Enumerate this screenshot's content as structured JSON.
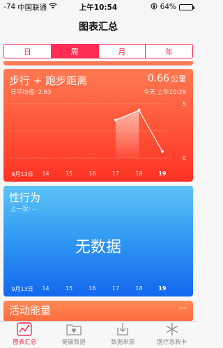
{
  "status": {
    "signal": "-74",
    "carrier": "中国联通",
    "time": "上午10:54",
    "battery": "64%",
    "battery_level": 0.64
  },
  "header": {
    "title": "图表汇总"
  },
  "segments": [
    {
      "label": "日",
      "active": false
    },
    {
      "label": "周",
      "active": true
    },
    {
      "label": "月",
      "active": false
    },
    {
      "label": "年",
      "active": false
    }
  ],
  "cards": {
    "walk": {
      "title": "步行 + 跑步距离",
      "sub": "日平均值: 2.63",
      "value": "0.66",
      "unit": "公里",
      "time": "今天 上午10:29"
    },
    "sex": {
      "title": "性行为",
      "sub": "上一次: --",
      "empty": "无数据"
    },
    "energy": {
      "title": "活动能量",
      "value": "--"
    }
  },
  "chart_data": [
    {
      "type": "area",
      "x": [
        "9月13日",
        "14",
        "15",
        "16",
        "17",
        "18",
        "19"
      ],
      "series": [
        {
          "values": [
            null,
            null,
            null,
            null,
            3.5,
            4.4,
            0.6
          ]
        }
      ],
      "ylim": [
        0,
        5
      ],
      "yticks": [
        "5",
        "0"
      ],
      "grid": true,
      "title": "",
      "xlabel": "",
      "ylabel": ""
    },
    {
      "type": "line",
      "x": [
        "9月13日",
        "14",
        "15",
        "16",
        "17",
        "18",
        "19"
      ],
      "series": [],
      "grid": false,
      "title": "",
      "xlabel": "",
      "ylabel": ""
    }
  ],
  "tabs": [
    {
      "label": "图表汇总",
      "icon": "dashboard-icon",
      "active": true
    },
    {
      "label": "健康数据",
      "icon": "health-data-icon",
      "active": false
    },
    {
      "label": "数据来源",
      "icon": "sources-icon",
      "active": false
    },
    {
      "label": "医疗急救卡",
      "icon": "medical-id-icon",
      "active": false
    }
  ],
  "colors": {
    "accent": "#ff2d55",
    "walk_top": "#ff7a52",
    "walk_bottom": "#ff3223",
    "sex_top": "#5cc4f6",
    "sex_bottom": "#1467ee"
  }
}
